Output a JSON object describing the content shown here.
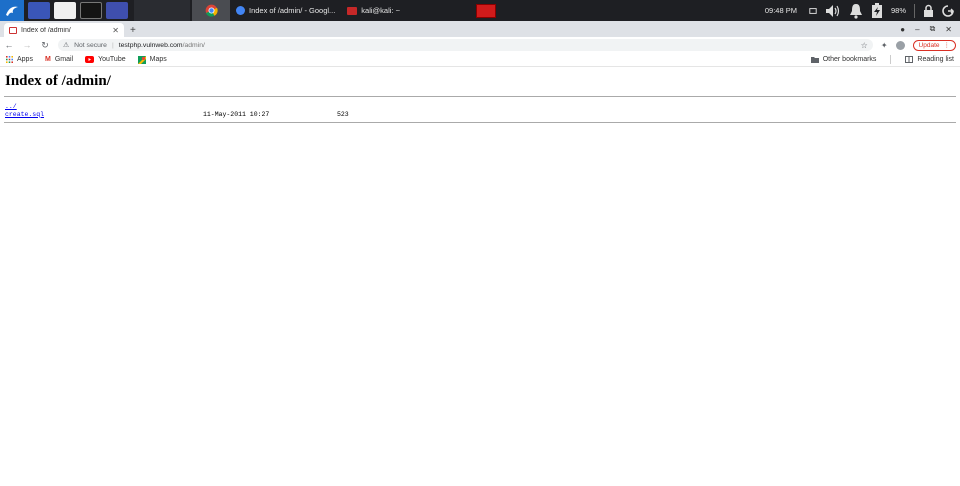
{
  "taskbar": {
    "tasks": [
      {
        "label": "Index of /admin/ - Googl..."
      },
      {
        "label": "kali@kali: ~"
      }
    ],
    "clock": "09:48 PM",
    "battery": "98%"
  },
  "browser": {
    "tab_title": "Index of /admin/",
    "address": {
      "security": "Not secure",
      "host": "testphp.vulnweb.com",
      "path": "/admin/"
    },
    "update_label": "Update",
    "bookmarks": [
      {
        "label": "Apps"
      },
      {
        "label": "Gmail"
      },
      {
        "label": "YouTube"
      },
      {
        "label": "Maps"
      }
    ],
    "other_bookmarks": "Other bookmarks",
    "reading_list": "Reading list"
  },
  "page": {
    "heading": "Index of /admin/",
    "entries": [
      {
        "name": "../",
        "date": "",
        "size": ""
      },
      {
        "name": "create.sql",
        "date": "11-May-2011 10:27",
        "size": "523"
      }
    ]
  },
  "colors": {
    "taskbar_bg": "#1e1f23",
    "kali_blue": "#1d6fc9",
    "link": "#0000ee",
    "update_red": "#d93025"
  }
}
